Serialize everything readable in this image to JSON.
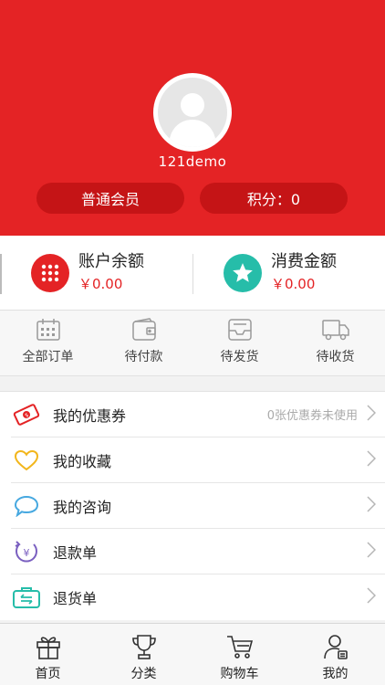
{
  "profile": {
    "username": "121demo",
    "member_level": "普通会员",
    "points": "积分：0"
  },
  "balance": {
    "account_label": "账户余额",
    "account_value": "￥0.00",
    "spend_label": "消费金额",
    "spend_value": "￥0.00"
  },
  "orders": [
    {
      "label": "全部订单",
      "icon": "calendar-icon"
    },
    {
      "label": "待付款",
      "icon": "wallet-icon"
    },
    {
      "label": "待发货",
      "icon": "tray-icon"
    },
    {
      "label": "待收货",
      "icon": "truck-icon"
    }
  ],
  "menu": [
    {
      "label": "我的优惠券",
      "hint": "0张优惠券未使用",
      "icon": "coupon-icon"
    },
    {
      "label": "我的收藏",
      "hint": "",
      "icon": "heart-icon"
    },
    {
      "label": "我的咨询",
      "hint": "",
      "icon": "chat-bubble-icon"
    },
    {
      "label": "退款单",
      "hint": "",
      "icon": "refund-icon"
    },
    {
      "label": "退货单",
      "hint": "",
      "icon": "return-box-icon"
    }
  ],
  "tabbar": [
    {
      "label": "首页",
      "icon": "gift-icon"
    },
    {
      "label": "分类",
      "icon": "trophy-icon"
    },
    {
      "label": "购物车",
      "icon": "cart-icon"
    },
    {
      "label": "我的",
      "icon": "user-icon"
    }
  ],
  "colors": {
    "brand_red": "#e42325",
    "pill_red": "#c51416",
    "teal": "#26bda9"
  }
}
